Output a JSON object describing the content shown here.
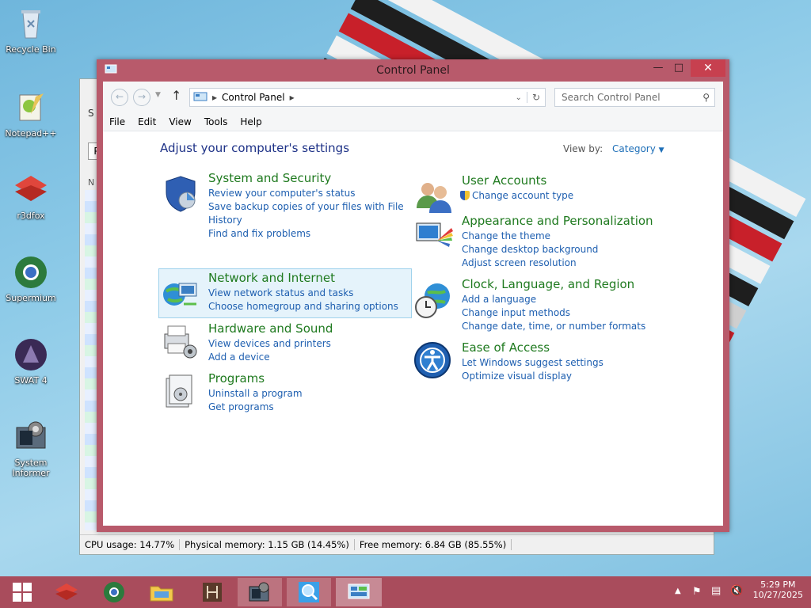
{
  "desktop": {
    "icons": [
      {
        "label": "Recycle Bin"
      },
      {
        "label": "Notepad++"
      },
      {
        "label": "r3dfox"
      },
      {
        "label": "Supermium"
      },
      {
        "label": "SWAT 4"
      },
      {
        "label": "System Informer"
      }
    ]
  },
  "background_window": {
    "status": {
      "cpu": "CPU usage: 14.77%",
      "physical": "Physical memory: 1.15 GB (14.45%)",
      "free": "Free memory: 6.84 GB (85.55%)"
    },
    "partial_labels": {
      "s": "S",
      "p": "P",
      "n": "N"
    }
  },
  "control_panel": {
    "title": "Control Panel",
    "address": {
      "crumb": "Control Panel"
    },
    "search": {
      "placeholder": "Search Control Panel"
    },
    "menu": [
      "File",
      "Edit",
      "View",
      "Tools",
      "Help"
    ],
    "heading": "Adjust your computer's settings",
    "view_by": {
      "label": "View by:",
      "value": "Category"
    },
    "categories_left": [
      {
        "title": "System and Security",
        "links": [
          "Review your computer's status",
          "Save backup copies of your files with File",
          "History",
          "Find and fix problems"
        ]
      },
      {
        "title": "Network and Internet",
        "links": [
          "View network status and tasks",
          "Choose homegroup and sharing options"
        ]
      },
      {
        "title": "Hardware and Sound",
        "links": [
          "View devices and printers",
          "Add a device"
        ]
      },
      {
        "title": "Programs",
        "links": [
          "Uninstall a program",
          "Get programs"
        ]
      }
    ],
    "categories_right": [
      {
        "title": "User Accounts",
        "links": [
          "Change account type"
        ]
      },
      {
        "title": "Appearance and Personalization",
        "links": [
          "Change the theme",
          "Change desktop background",
          "Adjust screen resolution"
        ]
      },
      {
        "title": "Clock, Language, and Region",
        "links": [
          "Add a language",
          "Change input methods",
          "Change date, time, or number formats"
        ]
      },
      {
        "title": "Ease of Access",
        "links": [
          "Let Windows suggest settings",
          "Optimize visual display"
        ]
      }
    ]
  },
  "taskbar": {
    "clock": {
      "time": "5:29 PM",
      "date": "10/27/2025"
    }
  },
  "colors": {
    "accent": "#b85a6b",
    "category_title": "#1f7a1f",
    "link": "#1e5fb0",
    "heading": "#1e3287"
  }
}
